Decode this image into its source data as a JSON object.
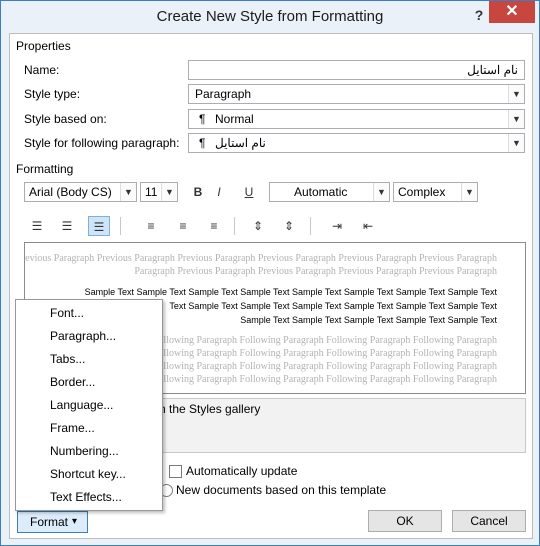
{
  "window": {
    "title": "Create New Style from Formatting",
    "help_label": "?",
    "close_label": "✕"
  },
  "properties": {
    "heading": "Properties",
    "name_label": "Name:",
    "name_value": "نام استایل",
    "style_type_label": "Style type:",
    "style_type_value": "Paragraph",
    "based_on_label": "Style based on:",
    "based_on_value": "Normal",
    "following_label": "Style for following paragraph:",
    "following_value": "نام استایل",
    "paragraph_mark": "¶"
  },
  "formatting": {
    "heading": "Formatting",
    "font": "Arial (Body CS)",
    "size": "11",
    "bold": "B",
    "italic": "I",
    "underline": "U",
    "color": "Automatic",
    "script": "Complex",
    "icons": [
      "align-left-icon",
      "align-center-icon",
      "align-right-icon",
      "single-spacing-icon",
      "one-half-spacing-icon",
      "double-spacing-icon",
      "increase-paragraph-spacing-icon",
      "decrease-paragraph-spacing-icon",
      "increase-indent-icon",
      "decrease-indent-icon"
    ]
  },
  "preview": {
    "prev1": "Previous Paragraph Previous Paragraph Previous Paragraph Previous Paragraph Previous Paragraph Previous Paragraph",
    "prev2": "Paragraph Previous Paragraph Previous Paragraph Previous Paragraph Previous Paragraph",
    "sample1": "Sample Text Sample Text Sample Text Sample Text Sample Text Sample Text Sample Text Sample Text",
    "sample2": "Text Sample Text Sample Text Sample Text Sample Text Sample Text Sample Text",
    "sample3": "Sample Text Sample Text Sample Text Sample Text Sample Text",
    "follow": "Following Paragraph Following Paragraph Following Paragraph Following Paragraph"
  },
  "description": "n the Styles gallery",
  "options": {
    "auto_update": "Automatically update",
    "new_documents": "New documents based on this template"
  },
  "buttons": {
    "format": "Format",
    "format_arrow": "▾",
    "ok": "OK",
    "cancel": "Cancel"
  },
  "menu": {
    "items": [
      "Font...",
      "Paragraph...",
      "Tabs...",
      "Border...",
      "Language...",
      "Frame...",
      "Numbering...",
      "Shortcut key...",
      "Text Effects..."
    ]
  }
}
